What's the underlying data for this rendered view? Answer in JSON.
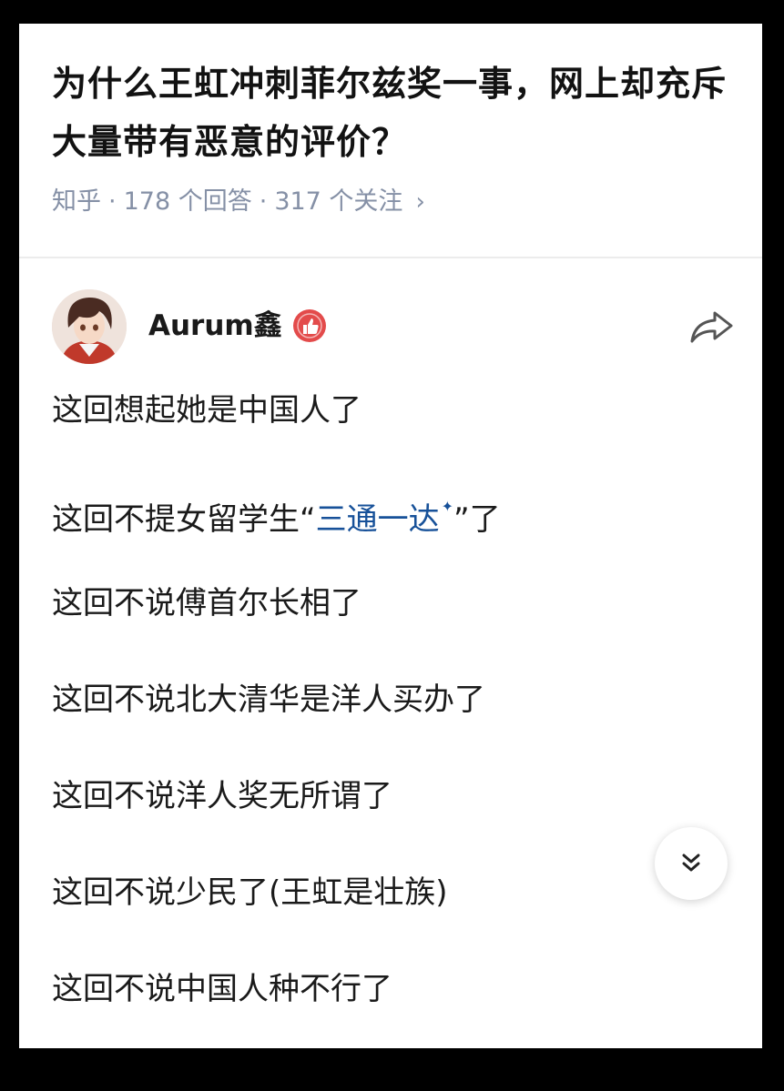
{
  "question": {
    "title": "为什么王虹冲刺菲尔兹奖一事，网上却充斥大量带有恶意的评价？",
    "meta": {
      "site": "知乎",
      "answers": "178 个回答",
      "followers": "317 个关注",
      "chevron_icon": "chevron-right-icon"
    }
  },
  "answer": {
    "author_name": "Aurum鑫",
    "badge_icon": "thumbs-up-badge-icon",
    "share_icon": "share-arrow-icon",
    "lines": [
      {
        "text": "这回想起她是中国人了"
      },
      {
        "before": "这回不提女留学生“",
        "link": "三通一达",
        "link_mark": "✦",
        "after": "”了"
      },
      {
        "text": "这回不说傅首尔长相了"
      },
      {
        "text": "这回不说北大清华是洋人买办了"
      },
      {
        "text": "这回不说洋人奖无所谓了"
      },
      {
        "text": "这回不说少民了(王虹是壮族)"
      },
      {
        "text": "这回不说中国人种不行了"
      }
    ]
  },
  "fab": {
    "icon": "double-chevron-down-icon"
  },
  "colors": {
    "link": "#175199",
    "meta": "#8590a6",
    "badge": "#e34b4b"
  }
}
